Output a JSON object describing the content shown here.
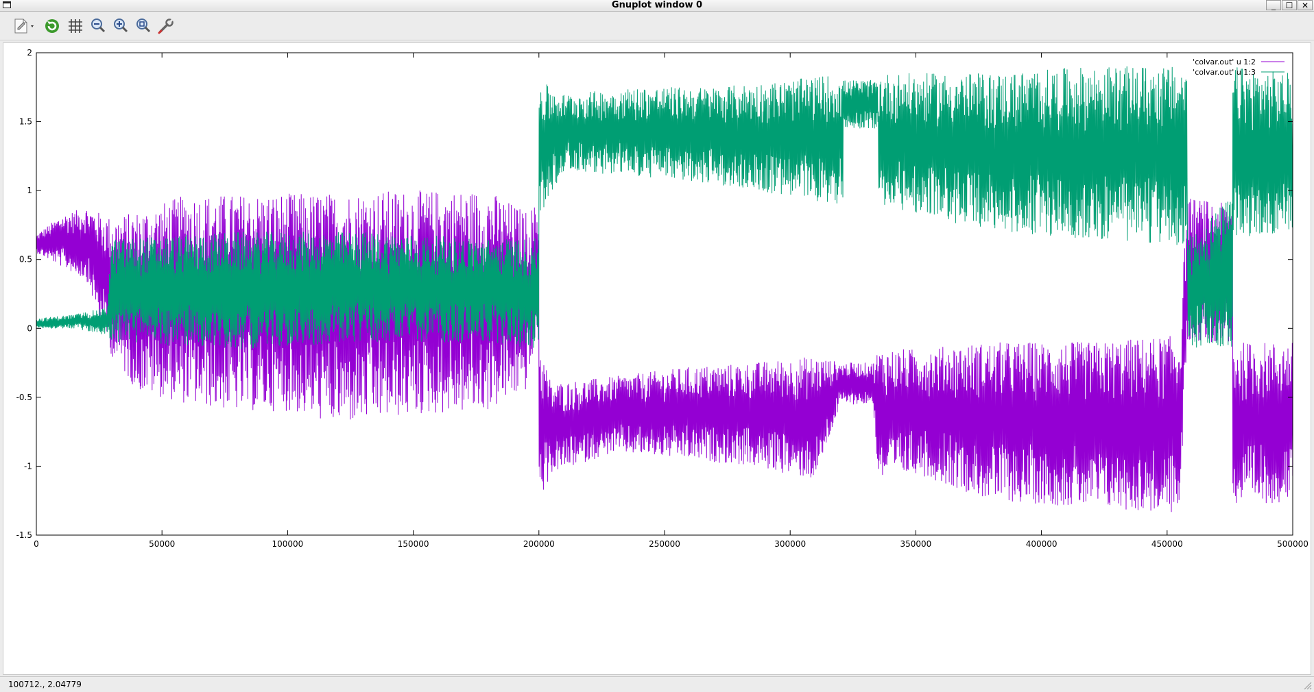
{
  "window": {
    "title": "Gnuplot window 0",
    "controls": {
      "minimize": "_",
      "maximize": "☐",
      "close": "✕"
    }
  },
  "toolbar": {
    "buttons": [
      {
        "name": "export-menu",
        "icon": "page-export-icon"
      },
      {
        "name": "replot",
        "icon": "refresh-icon"
      },
      {
        "name": "toggle-grid",
        "icon": "grid-icon"
      },
      {
        "name": "zoom-previous",
        "icon": "zoom-out-icon"
      },
      {
        "name": "zoom-next",
        "icon": "zoom-in-icon"
      },
      {
        "name": "autoscale",
        "icon": "zoom-fit-icon"
      },
      {
        "name": "options",
        "icon": "wrench-icon"
      }
    ]
  },
  "status": {
    "coords": "100712.,  2.04779"
  },
  "colors": {
    "series1": "#9400d3",
    "series2": "#009e73",
    "axis": "#000000"
  },
  "chart_data": {
    "type": "line",
    "title": "",
    "xlabel": "",
    "ylabel": "",
    "xlim": [
      0,
      500000
    ],
    "ylim": [
      -1.5,
      2
    ],
    "xticks": [
      0,
      50000,
      100000,
      150000,
      200000,
      250000,
      300000,
      350000,
      400000,
      450000,
      500000
    ],
    "xtick_labels": [
      "0",
      "50000",
      "100000",
      "150000",
      "200000",
      "250000",
      "300000",
      "350000",
      "400000",
      "450000",
      "500000"
    ],
    "yticks": [
      -1.5,
      -1,
      -0.5,
      0,
      0.5,
      1,
      1.5,
      2
    ],
    "ytick_labels": [
      "-1.5",
      "-1",
      "-0.5",
      "0",
      "0.5",
      "1",
      "1.5",
      "2"
    ],
    "grid": false,
    "legend_position": "top-right",
    "series": [
      {
        "name": "'colvar.out' u 1:2",
        "color": "#9400d3",
        "envelope": [
          {
            "x": 0,
            "low": 0.55,
            "high": 0.68
          },
          {
            "x": 10000,
            "low": 0.45,
            "high": 0.82
          },
          {
            "x": 20000,
            "low": 0.35,
            "high": 0.88
          },
          {
            "x": 30000,
            "low": -0.2,
            "high": 0.8
          },
          {
            "x": 40000,
            "low": -0.45,
            "high": 0.85
          },
          {
            "x": 60000,
            "low": -0.55,
            "high": 0.97
          },
          {
            "x": 80000,
            "low": -0.6,
            "high": 0.97
          },
          {
            "x": 100000,
            "low": -0.6,
            "high": 0.98
          },
          {
            "x": 120000,
            "low": -0.7,
            "high": 0.98
          },
          {
            "x": 140000,
            "low": -0.65,
            "high": 1.0
          },
          {
            "x": 160000,
            "low": -0.62,
            "high": 1.0
          },
          {
            "x": 180000,
            "low": -0.6,
            "high": 1.0
          },
          {
            "x": 195000,
            "low": -0.45,
            "high": 0.85
          },
          {
            "x": 199000,
            "low": -0.1,
            "high": 0.9
          },
          {
            "x": 200000,
            "low": -1.27,
            "high": -0.1
          },
          {
            "x": 205000,
            "low": -1.05,
            "high": -0.4
          },
          {
            "x": 230000,
            "low": -0.9,
            "high": -0.35
          },
          {
            "x": 260000,
            "low": -0.95,
            "high": -0.28
          },
          {
            "x": 285000,
            "low": -1.0,
            "high": -0.25
          },
          {
            "x": 310000,
            "low": -1.1,
            "high": -0.2
          },
          {
            "x": 320000,
            "low": -0.55,
            "high": -0.25
          },
          {
            "x": 333000,
            "low": -0.55,
            "high": -0.25
          },
          {
            "x": 335000,
            "low": -1.1,
            "high": -0.15
          },
          {
            "x": 350000,
            "low": -1.05,
            "high": -0.15
          },
          {
            "x": 380000,
            "low": -1.25,
            "high": -0.1
          },
          {
            "x": 420000,
            "low": -1.3,
            "high": -0.1
          },
          {
            "x": 455000,
            "low": -1.35,
            "high": -0.05
          },
          {
            "x": 458000,
            "low": -0.1,
            "high": 0.95
          },
          {
            "x": 475000,
            "low": -0.1,
            "high": 0.9
          },
          {
            "x": 476000,
            "low": -1.3,
            "high": -0.1
          },
          {
            "x": 500000,
            "low": -1.25,
            "high": -0.1
          }
        ]
      },
      {
        "name": "'colvar.out' u 1:3",
        "color": "#009e73",
        "envelope": [
          {
            "x": 0,
            "low": 0.0,
            "high": 0.07
          },
          {
            "x": 15000,
            "low": 0.0,
            "high": 0.1
          },
          {
            "x": 28000,
            "low": -0.05,
            "high": 0.15
          },
          {
            "x": 30000,
            "low": -0.1,
            "high": 0.65
          },
          {
            "x": 80000,
            "low": -0.15,
            "high": 0.7
          },
          {
            "x": 130000,
            "low": -0.1,
            "high": 0.7
          },
          {
            "x": 180000,
            "low": -0.1,
            "high": 0.65
          },
          {
            "x": 199000,
            "low": -0.15,
            "high": 0.65
          },
          {
            "x": 200000,
            "low": 0.8,
            "high": 1.8
          },
          {
            "x": 210000,
            "low": 1.15,
            "high": 1.7
          },
          {
            "x": 240000,
            "low": 1.1,
            "high": 1.75
          },
          {
            "x": 270000,
            "low": 1.05,
            "high": 1.75
          },
          {
            "x": 300000,
            "low": 0.95,
            "high": 1.8
          },
          {
            "x": 320000,
            "low": 0.9,
            "high": 1.85
          },
          {
            "x": 321000,
            "low": 1.45,
            "high": 1.8
          },
          {
            "x": 334000,
            "low": 1.45,
            "high": 1.8
          },
          {
            "x": 335000,
            "low": 0.9,
            "high": 1.85
          },
          {
            "x": 380000,
            "low": 0.7,
            "high": 1.85
          },
          {
            "x": 420000,
            "low": 0.65,
            "high": 1.9
          },
          {
            "x": 457000,
            "low": 0.6,
            "high": 1.9
          },
          {
            "x": 458000,
            "low": -0.15,
            "high": 0.65
          },
          {
            "x": 475000,
            "low": -0.15,
            "high": 0.95
          },
          {
            "x": 476000,
            "low": 0.65,
            "high": 1.9
          },
          {
            "x": 500000,
            "low": 0.7,
            "high": 1.85
          }
        ]
      }
    ]
  }
}
